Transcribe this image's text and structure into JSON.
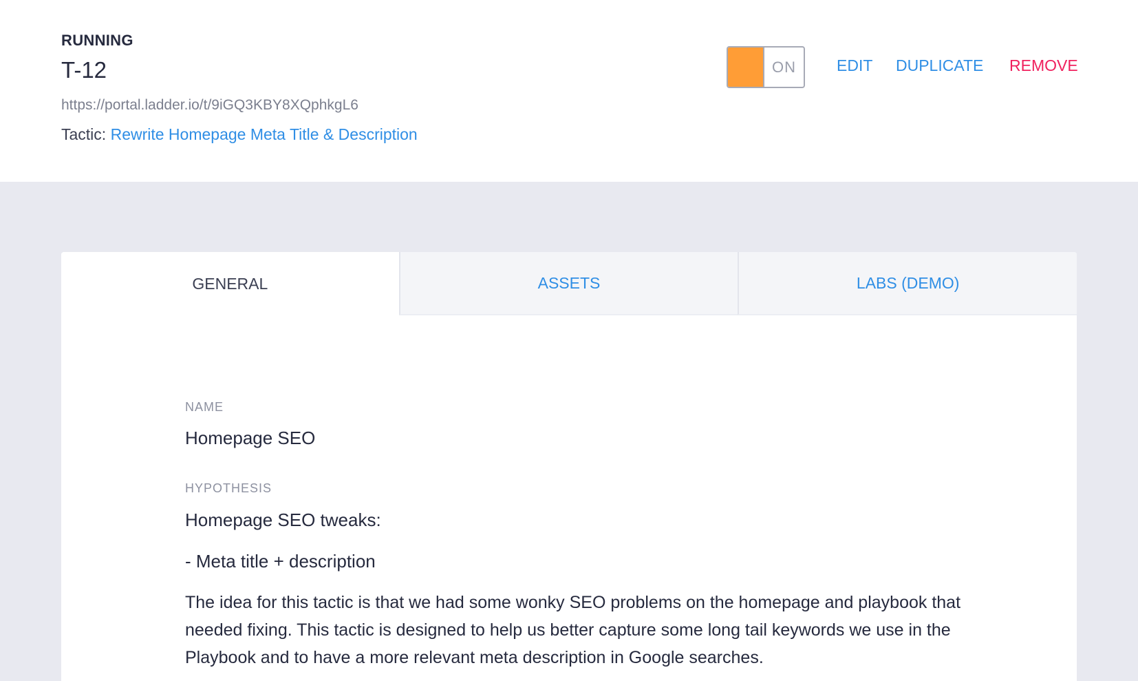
{
  "header": {
    "status": "RUNNING",
    "code": "T-12",
    "url": "https://portal.ladder.io/t/9iGQ3KBY8XQphkgL6",
    "tactic_prefix": "Tactic:",
    "tactic_link": "Rewrite Homepage Meta Title & Description",
    "toggle_label": "ON",
    "actions": {
      "edit": "EDIT",
      "duplicate": "DUPLICATE",
      "remove": "REMOVE"
    }
  },
  "tabs": [
    {
      "label": "GENERAL",
      "active": true
    },
    {
      "label": "ASSETS",
      "active": false
    },
    {
      "label": "LABS (DEMO)",
      "active": false
    }
  ],
  "general": {
    "name_label": "NAME",
    "name_value": "Homepage SEO",
    "hypothesis_label": "HYPOTHESIS",
    "hypothesis_lines": [
      "Homepage SEO tweaks:",
      "- Meta title + description",
      "The idea for this tactic is that we had some wonky SEO problems on the homepage and playbook that needed fixing. This tactic is designed to help us better capture some long tail keywords we use in the Playbook and to have a more relevant meta description in Google searches."
    ]
  },
  "colors": {
    "accent": "#2f8ee5",
    "danger": "#f0215e",
    "toggle_on": "#ff9d36",
    "page_bg": "#e8e9f0"
  }
}
